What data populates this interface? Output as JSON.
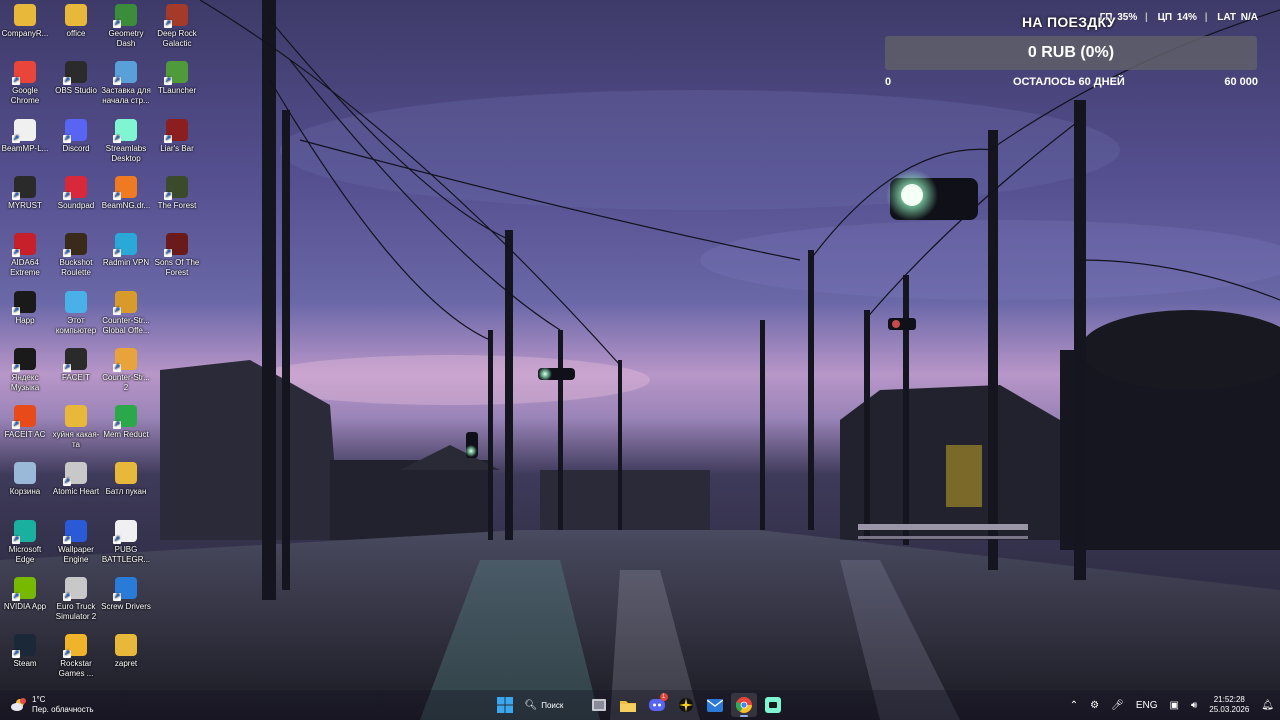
{
  "desktop": {
    "icons": [
      {
        "label": "CompanyR...",
        "icon": "folder-icon",
        "color": "#e8b83a"
      },
      {
        "label": "office",
        "icon": "folder-icon",
        "color": "#e8b83a"
      },
      {
        "label": "Geometry Dash",
        "icon": "geometry-dash-icon",
        "color": "#3b8d3b"
      },
      {
        "label": "Deep Rock Galactic",
        "icon": "deep-rock-galactic-icon",
        "color": "#a33a2a"
      },
      {
        "label": "Google Chrome",
        "icon": "chrome-icon",
        "color": "#e9453a"
      },
      {
        "label": "OBS Studio",
        "icon": "obs-icon",
        "color": "#2b2b2b"
      },
      {
        "label": "Заставка для начала стр...",
        "icon": "screensaver-icon",
        "color": "#5aa0d8"
      },
      {
        "label": "TLauncher",
        "icon": "tlauncher-icon",
        "color": "#4f9a3a"
      },
      {
        "label": "BeamMP-L...",
        "icon": "beammp-icon",
        "color": "#f0f0f0"
      },
      {
        "label": "Discord",
        "icon": "discord-icon",
        "color": "#5865f2"
      },
      {
        "label": "Streamlabs Desktop",
        "icon": "streamlabs-icon",
        "color": "#80f5d2"
      },
      {
        "label": "Liar's Bar",
        "icon": "liars-bar-icon",
        "color": "#8b1e1e"
      },
      {
        "label": "MYRUST",
        "icon": "myrust-icon",
        "color": "#2a2a2a"
      },
      {
        "label": "Soundpad",
        "icon": "soundpad-icon",
        "color": "#d8283a"
      },
      {
        "label": "BeamNG.dr...",
        "icon": "beamng-icon",
        "color": "#f07a22"
      },
      {
        "label": "The Forest",
        "icon": "the-forest-icon",
        "color": "#3a4a2a"
      },
      {
        "label": "AIDA64 Extreme",
        "icon": "aida64-icon",
        "color": "#c8202a"
      },
      {
        "label": "Buckshot Roulette",
        "icon": "buckshot-roulette-icon",
        "color": "#3a2a1a"
      },
      {
        "label": "Radmin VPN",
        "icon": "radmin-vpn-icon",
        "color": "#2aa8d8"
      },
      {
        "label": "Sons Of The Forest",
        "icon": "sons-of-the-forest-icon",
        "color": "#6a1a1a"
      },
      {
        "label": "Happ",
        "icon": "happ-icon",
        "color": "#1a1a1a"
      },
      {
        "label": "Этот компьютер",
        "icon": "this-pc-icon",
        "color": "#4ab0e8"
      },
      {
        "label": "Counter-Str... Global Offe...",
        "icon": "csgo-icon",
        "color": "#d89a2a"
      },
      {
        "label": "",
        "icon": "empty-slot",
        "color": "transparent"
      },
      {
        "label": "Яндекс Музыка",
        "icon": "yandex-music-icon",
        "color": "#1a1a1a"
      },
      {
        "label": "FACEIT",
        "icon": "faceit-icon",
        "color": "#2a2a2a"
      },
      {
        "label": "Counter-Str... 2",
        "icon": "cs2-icon",
        "color": "#e8a43a"
      },
      {
        "label": "",
        "icon": "empty-slot",
        "color": "transparent"
      },
      {
        "label": "FACEIT AC",
        "icon": "faceit-ac-icon",
        "color": "#e84a1a"
      },
      {
        "label": "хуйня какая-та",
        "icon": "folder-icon",
        "color": "#e8b83a"
      },
      {
        "label": "Mem Reduct",
        "icon": "mem-reduct-icon",
        "color": "#2aa84a"
      },
      {
        "label": "",
        "icon": "empty-slot",
        "color": "transparent"
      },
      {
        "label": "Корзина",
        "icon": "recycle-bin-icon",
        "color": "#9ab8d8"
      },
      {
        "label": "Atomic Heart",
        "icon": "atomic-heart-icon",
        "color": "#c8c8c8"
      },
      {
        "label": "Батл пукан",
        "icon": "folder-icon",
        "color": "#e8b83a"
      },
      {
        "label": "",
        "icon": "empty-slot",
        "color": "transparent"
      },
      {
        "label": "Microsoft Edge",
        "icon": "edge-icon",
        "color": "#1ab0a0"
      },
      {
        "label": "Wallpaper Engine",
        "icon": "wallpaper-engine-icon",
        "color": "#2a5ad8"
      },
      {
        "label": "PUBG BATTLEGR...",
        "icon": "pubg-icon",
        "color": "#f0f0f0"
      },
      {
        "label": "",
        "icon": "empty-slot",
        "color": "transparent"
      },
      {
        "label": "NVIDIA App",
        "icon": "nvidia-icon",
        "color": "#76b900"
      },
      {
        "label": "Euro Truck Simulator 2",
        "icon": "euro-truck-icon",
        "color": "#c8c8c8"
      },
      {
        "label": "Screw Drivers",
        "icon": "screw-drivers-icon",
        "color": "#2a7ad8"
      },
      {
        "label": "",
        "icon": "empty-slot",
        "color": "transparent"
      },
      {
        "label": "Steam",
        "icon": "steam-icon",
        "color": "#1b2838"
      },
      {
        "label": "Rockstar Games ...",
        "icon": "rockstar-icon",
        "color": "#f0b42a"
      },
      {
        "label": "zapret",
        "icon": "folder-icon",
        "color": "#e8b83a"
      }
    ]
  },
  "widget": {
    "gpu_label": "ГП",
    "gpu_value": "35%",
    "cpu_label": "ЦП",
    "cpu_value": "14%",
    "lat_label": "LAT",
    "lat_value": "N/A",
    "goal_title": "НА ПОЕЗДКУ",
    "goal_amount": "0 RUB (0%)",
    "goal_progress": 0.0,
    "goal_min": "0",
    "goal_days": "ОСТАЛОСЬ 60 ДНЕЙ",
    "goal_max": "60 000"
  },
  "taskbar": {
    "weather_temp": "1°C",
    "weather_desc": "Пер. облачность",
    "search_label": "Поиск",
    "discord_badge": "1",
    "lang": "ENG",
    "time": "21:52:28",
    "date": "25.03.2026"
  }
}
